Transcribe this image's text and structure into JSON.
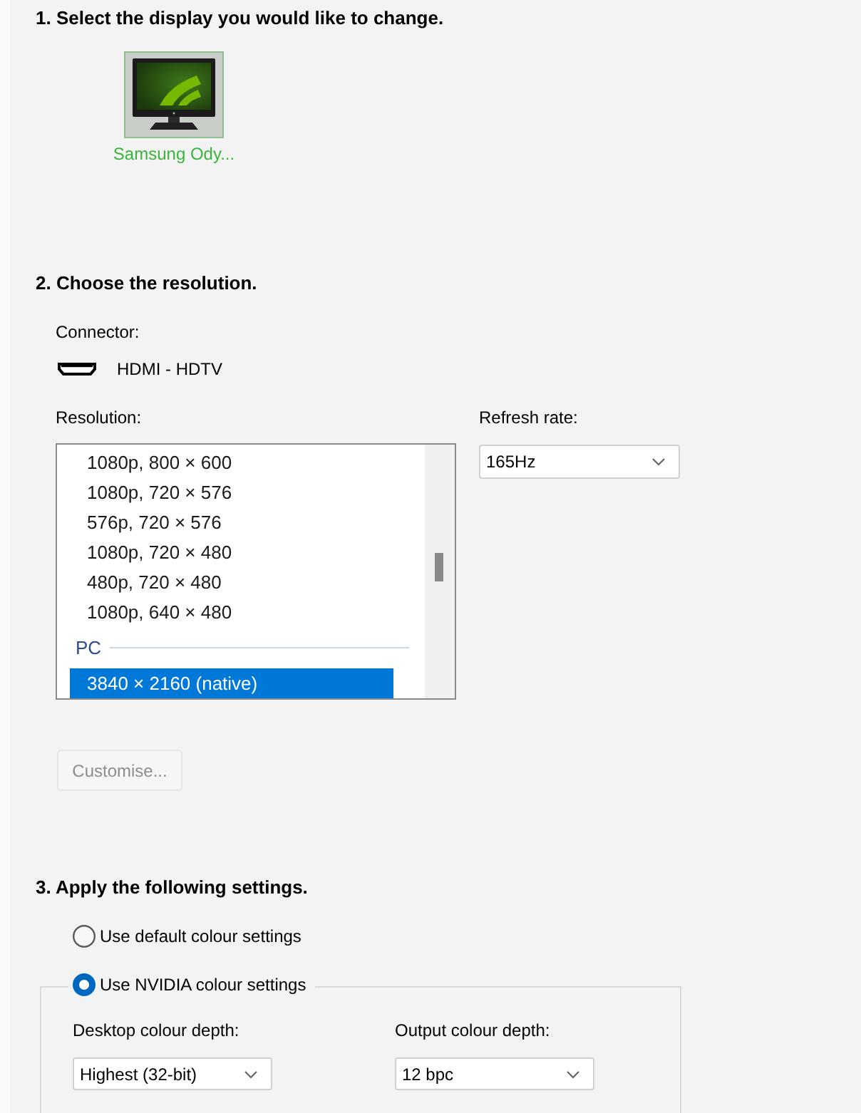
{
  "display_section": {
    "heading": "1. Select the display you would like to change.",
    "displays": [
      {
        "label": "Samsung Ody...",
        "selected": true
      }
    ]
  },
  "resolution_section": {
    "heading": "2. Choose the resolution.",
    "connector_label": "Connector:",
    "connector": "HDMI - HDTV",
    "resolution_label": "Resolution:",
    "resolutions": [
      {
        "kind": "item",
        "label": "1080p, 800 × 600",
        "selected": false
      },
      {
        "kind": "item",
        "label": "1080p, 720 × 576",
        "selected": false
      },
      {
        "kind": "item",
        "label": "576p, 720 × 576",
        "selected": false
      },
      {
        "kind": "item",
        "label": "1080p, 720 × 480",
        "selected": false
      },
      {
        "kind": "item",
        "label": "480p, 720 × 480",
        "selected": false
      },
      {
        "kind": "item",
        "label": "1080p, 640 × 480",
        "selected": false
      },
      {
        "kind": "group",
        "label": "PC",
        "selected": false
      },
      {
        "kind": "item",
        "label": "3840 × 2160 (native)",
        "selected": true
      }
    ],
    "refresh_label": "Refresh rate:",
    "refresh_rate": "165Hz",
    "customise_button": {
      "label": "Customise...",
      "disabled": true
    }
  },
  "colour_section": {
    "heading": "3. Apply the following settings.",
    "options": [
      {
        "label": "Use default colour settings",
        "selected": false
      },
      {
        "label": "Use NVIDIA colour settings",
        "selected": true
      }
    ],
    "desktop_depth_label": "Desktop colour depth:",
    "desktop_depth": "Highest (32-bit)",
    "output_depth_label": "Output colour depth:",
    "output_depth": "12 bpc"
  }
}
